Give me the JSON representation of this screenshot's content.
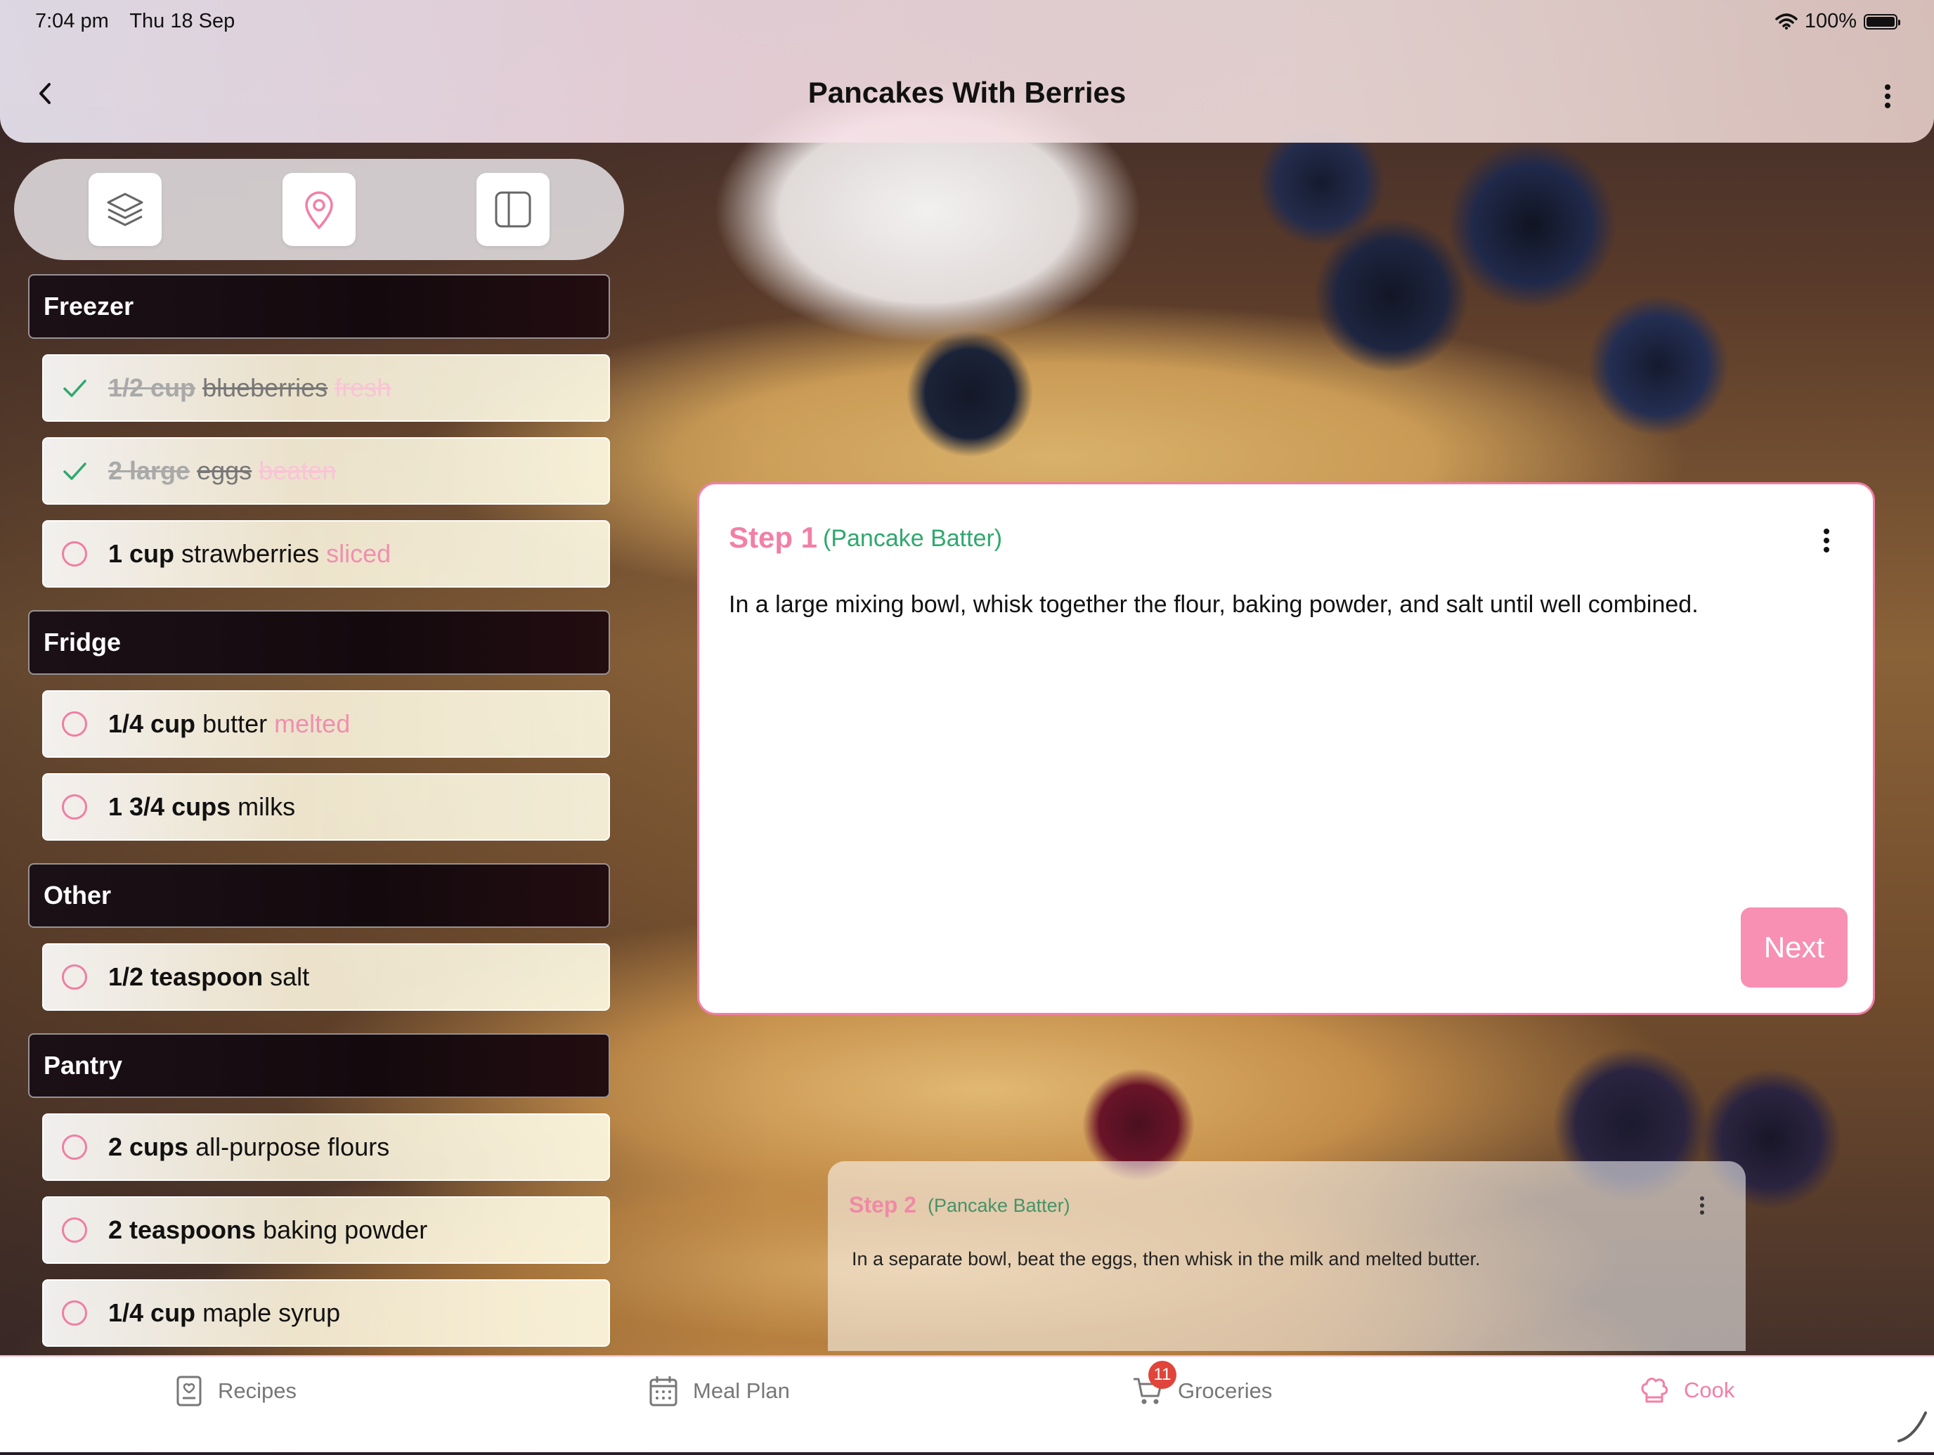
{
  "status_bar": {
    "time": "7:04 pm",
    "date": "Thu 18 Sep",
    "battery": "100%"
  },
  "header": {
    "title": "Pancakes With Berries"
  },
  "toolbar": {
    "icons": [
      "layers-icon",
      "location-pin-icon",
      "sidebar-panel-icon"
    ]
  },
  "sections": [
    {
      "title": "Freezer",
      "items": [
        {
          "qty": "1/2 cup",
          "name": "blueberries",
          "note": "fresh",
          "checked": true
        },
        {
          "qty": "2 large",
          "name": "eggs",
          "note": "beaten",
          "checked": true
        },
        {
          "qty": "1 cup",
          "name": "strawberries",
          "note": "sliced",
          "checked": false
        }
      ]
    },
    {
      "title": "Fridge",
      "items": [
        {
          "qty": "1/4 cup",
          "name": "butter",
          "note": "melted",
          "checked": false
        },
        {
          "qty": "1 3/4 cups",
          "name": "milks",
          "note": "",
          "checked": false
        }
      ]
    },
    {
      "title": "Other",
      "items": [
        {
          "qty": "1/2 teaspoon",
          "name": "salt",
          "note": "",
          "checked": false
        }
      ]
    },
    {
      "title": "Pantry",
      "items": [
        {
          "qty": "2 cups",
          "name": "all-purpose flours",
          "note": "",
          "checked": false
        },
        {
          "qty": "2 teaspoons",
          "name": "baking powder",
          "note": "",
          "checked": false
        },
        {
          "qty": "1/4 cup",
          "name": "maple syrup",
          "note": "",
          "checked": false
        }
      ]
    }
  ],
  "current_step": {
    "title": "Step 1",
    "subtitle": "(Pancake Batter)",
    "text": "In a large mixing bowl, whisk together the flour, baking powder, and salt until well combined.",
    "next_label": "Next"
  },
  "next_step": {
    "title": "Step 2",
    "subtitle": "(Pancake Batter)",
    "text": "In a separate bowl, beat the eggs, then whisk in the milk and melted butter."
  },
  "tabbar": {
    "tabs": [
      {
        "label": "Recipes",
        "icon": "recipe-book-icon"
      },
      {
        "label": "Meal Plan",
        "icon": "calendar-icon"
      },
      {
        "label": "Groceries",
        "icon": "cart-icon",
        "badge": "11"
      },
      {
        "label": "Cook",
        "icon": "chef-hat-icon",
        "active": true
      }
    ]
  },
  "colors": {
    "accent": "#f27fa6",
    "subtitle_green": "#2fa86e",
    "badge_red": "#e0443a"
  }
}
